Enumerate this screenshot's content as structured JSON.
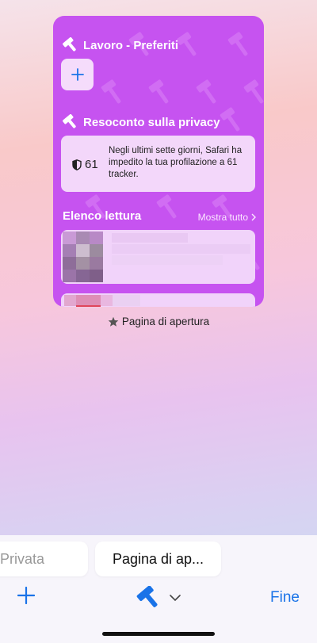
{
  "start_card": {
    "favorites_title": "Lavoro - Preferiti",
    "privacy_title": "Resoconto sulla privacy",
    "privacy_count": "61",
    "privacy_text": "Negli ultimi sette giorni, Safari ha impedito la tua profilazione a 61 tracker.",
    "reading_title": "Elenco lettura",
    "show_all": "Mostra tutto",
    "accent": "#c653f0"
  },
  "caption": "Pagina di apertura",
  "tabs": [
    {
      "label": "Privata"
    },
    {
      "label": "Pagina di ap..."
    }
  ],
  "toolbar": {
    "done_label": "Fine",
    "accent": "#1a73e8"
  }
}
